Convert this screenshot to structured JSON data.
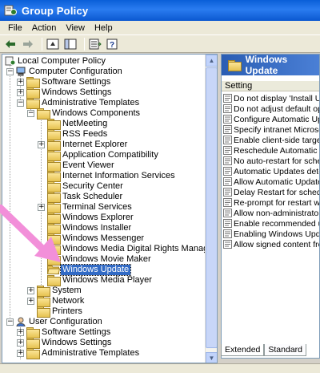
{
  "window": {
    "title": "Group Policy"
  },
  "menu": [
    "File",
    "Action",
    "View",
    "Help"
  ],
  "tree": {
    "items": [
      {
        "label": "Local Computer Policy",
        "icon": "policy-icon"
      },
      {
        "label": "Computer Configuration",
        "icon": "computer-icon"
      },
      {
        "label": "Software Settings",
        "icon": "folder-icon"
      },
      {
        "label": "Windows Settings",
        "icon": "folder-icon"
      },
      {
        "label": "Administrative Templates",
        "icon": "folder-icon"
      },
      {
        "label": "Windows Components",
        "icon": "folder-icon"
      },
      {
        "label": "NetMeeting",
        "icon": "folder-icon"
      },
      {
        "label": "RSS Feeds",
        "icon": "folder-icon"
      },
      {
        "label": "Internet Explorer",
        "icon": "folder-icon"
      },
      {
        "label": "Application Compatibility",
        "icon": "folder-icon"
      },
      {
        "label": "Event Viewer",
        "icon": "folder-icon"
      },
      {
        "label": "Internet Information Services",
        "icon": "folder-icon"
      },
      {
        "label": "Security Center",
        "icon": "folder-icon"
      },
      {
        "label": "Task Scheduler",
        "icon": "folder-icon"
      },
      {
        "label": "Terminal Services",
        "icon": "folder-icon"
      },
      {
        "label": "Windows Explorer",
        "icon": "folder-icon"
      },
      {
        "label": "Windows Installer",
        "icon": "folder-icon"
      },
      {
        "label": "Windows Messenger",
        "icon": "folder-icon"
      },
      {
        "label": "Windows Media Digital Rights Management",
        "icon": "folder-icon"
      },
      {
        "label": "Windows Movie Maker",
        "icon": "folder-icon"
      },
      {
        "label": "Windows Update",
        "icon": "folder-open-icon",
        "selected": true
      },
      {
        "label": "Windows Media Player",
        "icon": "folder-icon"
      },
      {
        "label": "System",
        "icon": "folder-icon"
      },
      {
        "label": "Network",
        "icon": "folder-icon"
      },
      {
        "label": "Printers",
        "icon": "folder-icon"
      },
      {
        "label": "User Configuration",
        "icon": "user-icon"
      },
      {
        "label": "Software Settings",
        "icon": "folder-icon"
      },
      {
        "label": "Windows Settings",
        "icon": "folder-icon"
      },
      {
        "label": "Administrative Templates",
        "icon": "folder-icon"
      }
    ]
  },
  "right": {
    "title": "Windows Update",
    "column_header": "Setting",
    "settings": [
      "Do not display 'Install Upda",
      "Do not adjust default option",
      "Configure Automatic Update",
      "Specify intranet Microsoft u",
      "Enable client-side targeting",
      "Reschedule Automatic Upda",
      "No auto-restart for schedul",
      "Automatic Updates detectio",
      "Allow Automatic Updates im",
      "Delay Restart for scheduled",
      "Re-prompt for restart with s",
      "Allow non-administrators to",
      "Enable recommended updat",
      "Enabling Windows Update P",
      "Allow signed content from in"
    ],
    "tabs": [
      "Extended",
      "Standard"
    ]
  },
  "colors": {
    "title_bar": "#0a5fd8",
    "selection": "#316ac5",
    "annotation_arrow": "#f28fd9"
  }
}
